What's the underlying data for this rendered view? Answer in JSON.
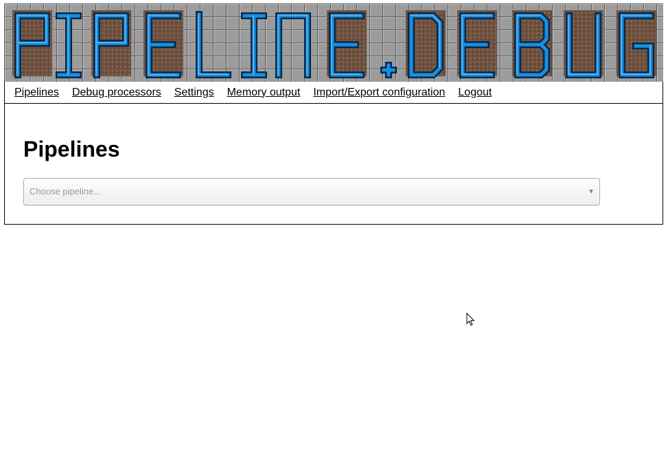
{
  "banner": {
    "logo_text": "PIPELINE.DEBUG",
    "colors": {
      "pipe": "#1a8fe0",
      "pipe_dark": "#05294a",
      "tile": "#9c9c9c",
      "rust": "#7a5a45"
    }
  },
  "nav": {
    "items": [
      {
        "label": "Pipelines"
      },
      {
        "label": "Debug processors"
      },
      {
        "label": "Settings"
      },
      {
        "label": "Memory output"
      },
      {
        "label": "Import/Export configuration"
      },
      {
        "label": "Logout"
      }
    ]
  },
  "main": {
    "title": "Pipelines",
    "pipeline_select": {
      "placeholder": "Choose pipeline...",
      "icon": "chevron-down-icon"
    }
  },
  "cursor": {
    "icon": "mouse-pointer-icon"
  }
}
